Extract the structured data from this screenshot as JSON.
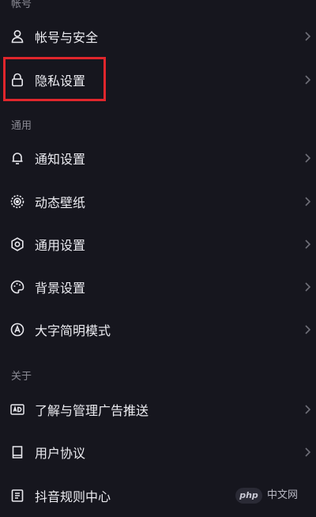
{
  "sections": {
    "account": "帐号",
    "general": "通用",
    "about": "关于"
  },
  "items": [
    {
      "label": "帐号与安全",
      "icon": "user-icon"
    },
    {
      "label": "隐私设置",
      "icon": "lock-icon"
    },
    {
      "label": "通知设置",
      "icon": "bell-icon"
    },
    {
      "label": "动态壁纸",
      "icon": "wallpaper-icon"
    },
    {
      "label": "通用设置",
      "icon": "gear-icon"
    },
    {
      "label": "背景设置",
      "icon": "palette-icon"
    },
    {
      "label": "大字简明模式",
      "icon": "font-size-icon"
    },
    {
      "label": "了解与管理广告推送",
      "icon": "ad-icon"
    },
    {
      "label": "用户协议",
      "icon": "book-icon"
    },
    {
      "label": "抖音规则中心",
      "icon": "rules-icon"
    }
  ],
  "highlight_color": "#e0262c",
  "watermark": {
    "logo": "php",
    "text": "中文网"
  }
}
